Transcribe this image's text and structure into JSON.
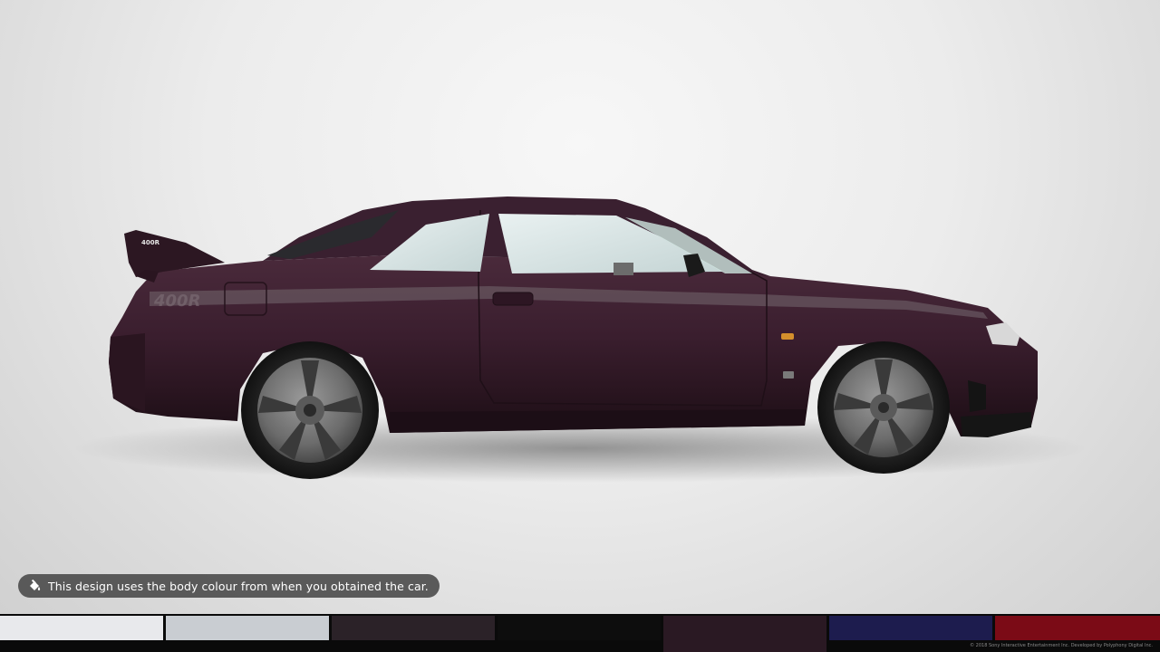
{
  "scene": {
    "car_body_color": "#3a1e2e",
    "stripe_color": "#6a5a62",
    "decal_text": "400R",
    "badge_text": "400R"
  },
  "tooltip": {
    "icon": "paint-bucket-icon",
    "text": "This design uses the body colour from when you obtained the car."
  },
  "swatches": [
    {
      "name": "white",
      "color": "#e8e9ec"
    },
    {
      "name": "silver",
      "color": "#c9cdd2"
    },
    {
      "name": "dark-purple-grey",
      "color": "#2b2228"
    },
    {
      "name": "black",
      "color": "#0d0d0d"
    },
    {
      "name": "midnight-purple",
      "color": "#2a1923",
      "selected": true
    },
    {
      "name": "navy-blue",
      "color": "#1d1c4e"
    },
    {
      "name": "red",
      "color": "#7b0b16"
    }
  ],
  "footer": {
    "copyright": "© 2018 Sony Interactive Entertainment Inc. Developed by Polyphony Digital Inc."
  }
}
